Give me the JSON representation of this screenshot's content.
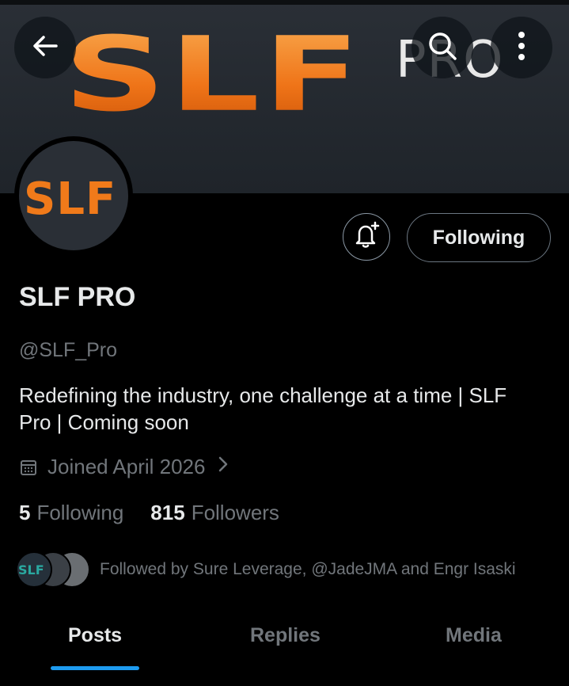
{
  "banner": {
    "logo_text": "SLF",
    "logo_suffix": "PRO",
    "brand_color": "#f07a1a"
  },
  "nav": {
    "back_icon": "arrow-left-icon",
    "search_icon": "search-icon",
    "more_icon": "more-vertical-icon"
  },
  "avatar": {
    "text": "SLF"
  },
  "actions": {
    "notify_icon": "bell-plus-icon",
    "following_label": "Following"
  },
  "profile": {
    "name": "SLF PRO",
    "handle": "@SLF_Pro",
    "bio": "Redefining the industry, one challenge at a time | SLF Pro | Coming soon",
    "joined": "Joined April 2026"
  },
  "stats": {
    "following_count": "5",
    "following_label": "Following",
    "followers_count": "815",
    "followers_label": "Followers"
  },
  "followed_by": {
    "first_avatar_text": "SLF",
    "text": "Followed by Sure Leverage, @JadeJMA and Engr Isaski"
  },
  "tabs": [
    {
      "label": "Posts",
      "active": true
    },
    {
      "label": "Replies",
      "active": false
    },
    {
      "label": "Media",
      "active": false
    }
  ],
  "colors": {
    "accent": "#1d9bf0",
    "muted": "#71767b",
    "text": "#e7e9ea"
  }
}
